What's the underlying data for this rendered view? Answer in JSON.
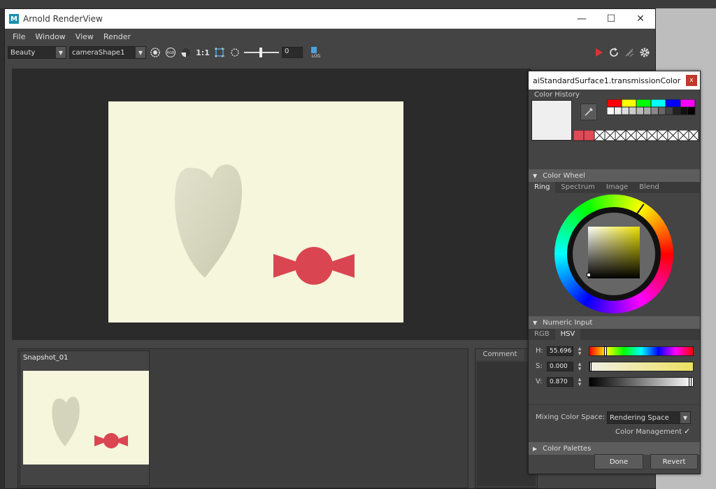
{
  "window": {
    "title": "Arnold RenderView",
    "minimize": "—",
    "maximize": "☐",
    "close": "✕"
  },
  "menu": [
    "File",
    "Window",
    "View",
    "Render"
  ],
  "toolbar": {
    "aov": "Beauty",
    "camera": "cameraShape1",
    "ratio": "1:1",
    "exposure": "0",
    "log_label": "LOG"
  },
  "snapshot": {
    "label": "Snapshot_01"
  },
  "comment": {
    "tab": "Comment"
  },
  "color_dialog": {
    "title": "aiStandardSurface1.transmissionColor",
    "close": "x",
    "history_label": "Color History",
    "wheel_label": "Color Wheel",
    "wheel_tabs": [
      "Ring",
      "Spectrum",
      "Image",
      "Blend"
    ],
    "numeric_label": "Numeric Input",
    "numeric_tabs": [
      "RGB",
      "HSV"
    ],
    "h_label": "H:",
    "h_value": "55.696",
    "s_label": "S:",
    "s_value": "0.000",
    "v_label": "V:",
    "v_value": "0.870",
    "mixing_label": "Mixing Color Space:",
    "mixing_value": "Rendering Space",
    "cm_label": "Color Management",
    "palettes_label": "Color Palettes",
    "done": "Done",
    "revert": "Revert"
  },
  "colors": {
    "accent_red": "#e04a55",
    "render_bg": "#f5f6dc",
    "candy": "#d94651"
  }
}
